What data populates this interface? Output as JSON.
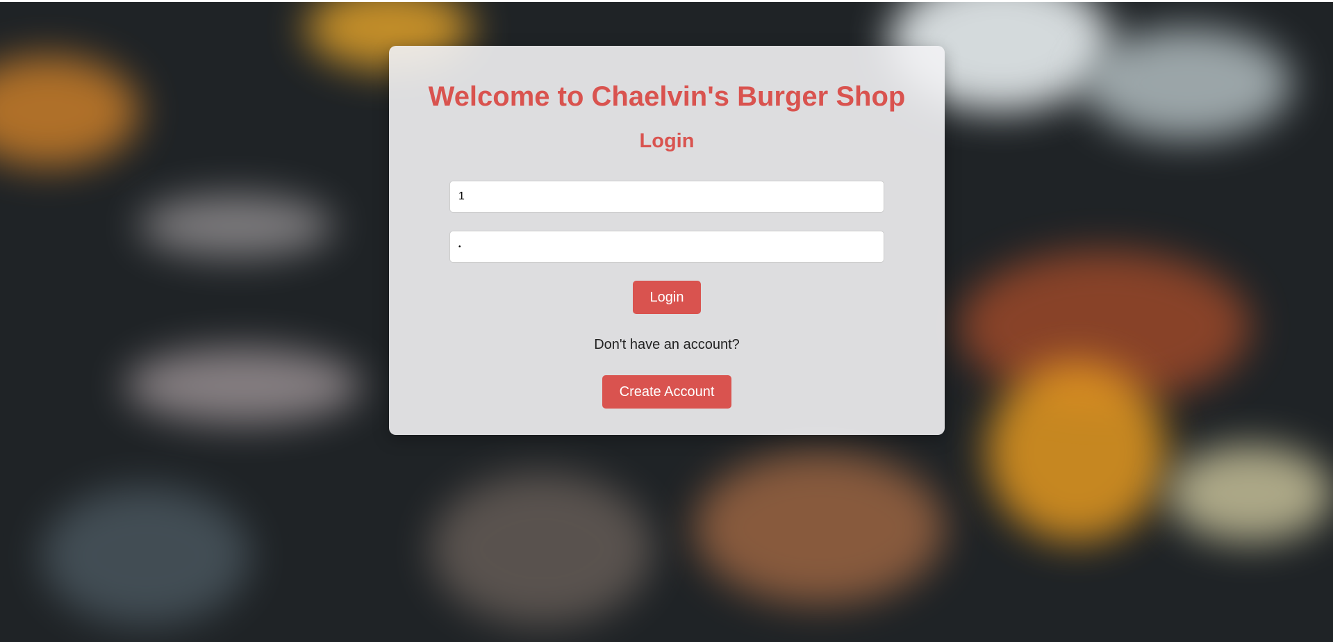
{
  "header": {
    "title": "Welcome to Chaelvin's Burger Shop",
    "subtitle": "Login"
  },
  "form": {
    "username_value": "1",
    "password_value": "1",
    "login_label": "Login",
    "signup_prompt": "Don't have an account?",
    "create_account_label": "Create Account"
  },
  "colors": {
    "accent": "#d9534f",
    "card_background": "#f2f2f4"
  }
}
